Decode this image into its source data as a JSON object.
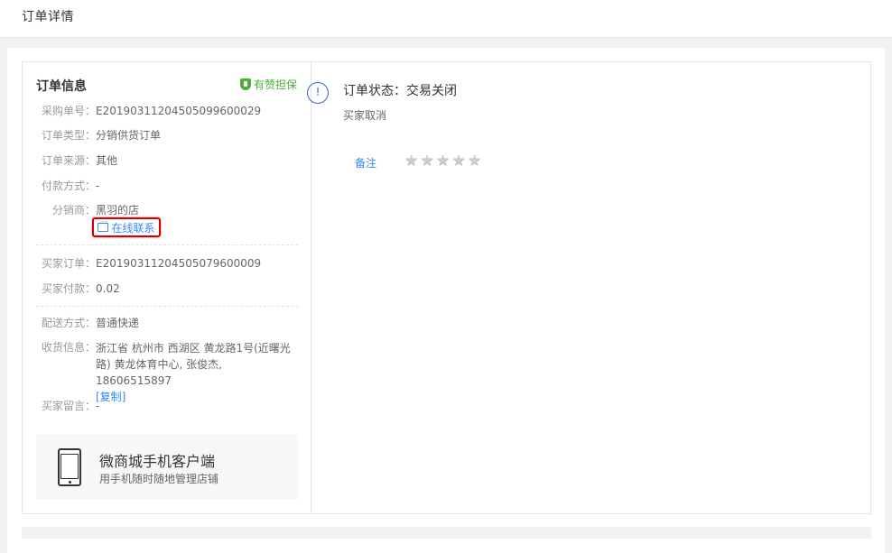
{
  "page": {
    "title": "订单详情"
  },
  "order_info": {
    "title": "订单信息",
    "guarantee": "有赞担保",
    "purchase_no_label": "采购单号：",
    "purchase_no": "E20190311204505099600029",
    "order_type_label": "订单类型：",
    "order_type": "分销供货订单",
    "order_source_label": "订单来源：",
    "order_source": "其他",
    "payment_method_label": "付款方式：",
    "payment_method": "-",
    "distributor_label": "分销商：",
    "distributor": "黑羽的店",
    "contact_label": "在线联系",
    "buyer_order_label": "买家订单：",
    "buyer_order": "E20190311204505079600009",
    "buyer_payment_label": "买家付款：",
    "buyer_payment": "0.02",
    "delivery_label": "配送方式：",
    "delivery": "普通快递",
    "receiver_label": "收货信息：",
    "receiver": "浙江省 杭州市 西湖区 黄龙路1号(近曙光路) 黄龙体育中心, 张俊杰, 18606515897",
    "copy_label": "[复制]",
    "buyer_message_label": "买家留言：",
    "buyer_message": "-"
  },
  "app_promo": {
    "title": "微商城手机客户端",
    "subtitle": "用手机随时随地管理店铺"
  },
  "status": {
    "icon": "!",
    "text": "订单状态：交易关闭",
    "sub": "买家取消",
    "remark_label": "备注",
    "stars": [
      "★",
      "★",
      "★",
      "★",
      "★"
    ],
    "rating": 0
  },
  "colors": {
    "accent_blue": "#3388ff",
    "guarantee_green": "#4caf3a",
    "highlight_red": "#d40000"
  }
}
